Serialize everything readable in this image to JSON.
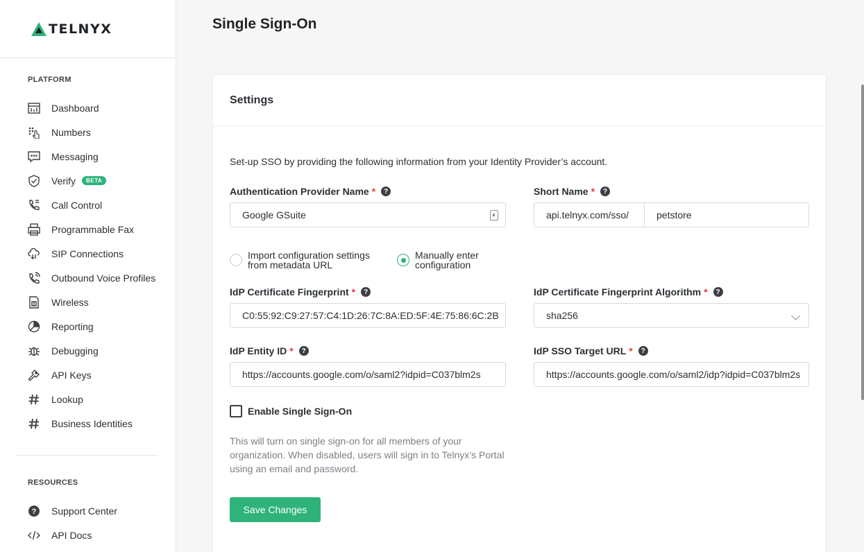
{
  "brand": {
    "logo_text": "TELNYX",
    "accent": "#2fb37b"
  },
  "sidebar": {
    "platform_label": "PLATFORM",
    "items": [
      {
        "label": "Dashboard",
        "icon": "dashboard-icon"
      },
      {
        "label": "Numbers",
        "icon": "numbers-icon"
      },
      {
        "label": "Messaging",
        "icon": "messaging-icon"
      },
      {
        "label": "Verify",
        "icon": "shield-check-icon",
        "badge": "BETA"
      },
      {
        "label": "Call Control",
        "icon": "phone-icon"
      },
      {
        "label": "Programmable Fax",
        "icon": "fax-icon"
      },
      {
        "label": "SIP Connections",
        "icon": "cloud-icon"
      },
      {
        "label": "Outbound Voice Profiles",
        "icon": "phone-outgoing-icon"
      },
      {
        "label": "Wireless",
        "icon": "sim-card-icon"
      },
      {
        "label": "Reporting",
        "icon": "pie-chart-icon"
      },
      {
        "label": "Debugging",
        "icon": "bug-icon"
      },
      {
        "label": "API Keys",
        "icon": "key-icon"
      },
      {
        "label": "Lookup",
        "icon": "hash-icon"
      },
      {
        "label": "Business Identities",
        "icon": "hash-icon"
      }
    ],
    "resources_label": "RESOURCES",
    "resources": [
      {
        "label": "Support Center",
        "icon": "question-circle-icon"
      },
      {
        "label": "API Docs",
        "icon": "code-icon"
      }
    ]
  },
  "main": {
    "page_title": "Single Sign-On",
    "card_title": "Settings",
    "intro": "Set-up SSO by providing the following information from your Identity Provider’s account.",
    "auth_provider": {
      "label": "Authentication Provider Name",
      "value": "Google GSuite"
    },
    "short_name": {
      "label": "Short Name",
      "prefix": "api.telnyx.com/sso/",
      "value": "petstore"
    },
    "radio_import": {
      "label": "Import configuration settings from metadata URL",
      "checked": false
    },
    "radio_manual": {
      "label": "Manually enter configuration",
      "checked": true
    },
    "fingerprint": {
      "label": "IdP Certificate Fingerprint",
      "value": "C0:55:92:C9:27:57:C4:1D:26:7C:8A:ED:5F:4E:75:86:6C:2B"
    },
    "fingerprint_algo": {
      "label": "IdP Certificate Fingerprint Algorithm",
      "value": "sha256"
    },
    "entity_id": {
      "label": "IdP Entity ID",
      "value": "https://accounts.google.com/o/saml2?idpid=C037blm2s"
    },
    "sso_target": {
      "label": "IdP SSO Target URL",
      "value": "https://accounts.google.com/o/saml2/idp?idpid=C037blm2s"
    },
    "enable_sso": {
      "label": "Enable Single Sign-On",
      "checked": false
    },
    "note": "This will turn on single sign-on for all members of your organization. When disabled, users will sign in to Telnyx’s Portal using an email and password.",
    "save_label": "Save Changes",
    "required_mark": "*",
    "help_glyph": "?"
  }
}
